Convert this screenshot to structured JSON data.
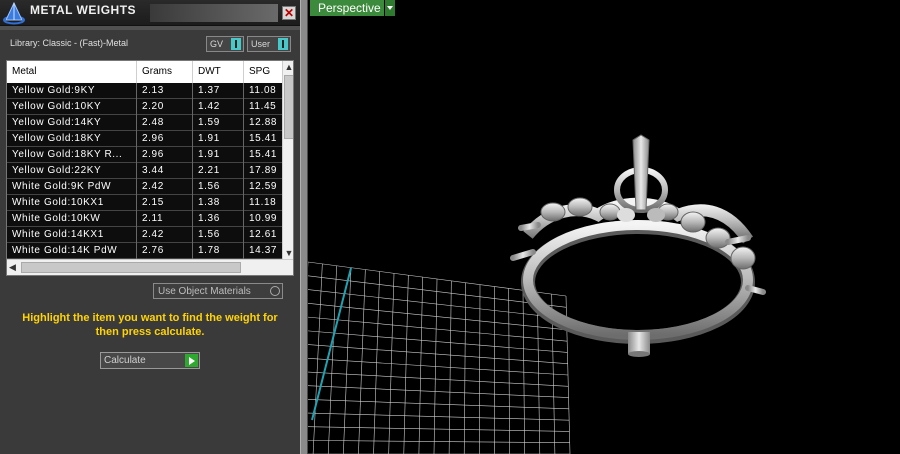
{
  "panel": {
    "title": "METAL WEIGHTS",
    "close_glyph": "✕",
    "library_label": "Library: Classic - (Fast)-Metal",
    "gv_select": "GV",
    "user_select": "User",
    "use_object_materials": "Use Object Materials",
    "hint": "Highlight the item you want to find the weight for then press calculate.",
    "calculate_label": "Calculate",
    "icons": {
      "logo": "pyramid-logo-icon",
      "close": "close-icon",
      "scroll_up": "arrow-up-icon",
      "scroll_down": "arrow-down-icon",
      "scroll_left": "arrow-left-icon",
      "calculate": "play-arrow-icon"
    }
  },
  "table": {
    "headers": [
      "Metal",
      "Grams",
      "DWT",
      "SPG"
    ],
    "rows": [
      [
        "Yellow Gold:9KY",
        "2.13",
        "1.37",
        "11.08"
      ],
      [
        "Yellow Gold:10KY",
        "2.20",
        "1.42",
        "11.45"
      ],
      [
        "Yellow Gold:14KY",
        "2.48",
        "1.59",
        "12.88"
      ],
      [
        "Yellow Gold:18KY",
        "2.96",
        "1.91",
        "15.41"
      ],
      [
        "Yellow Gold:18KY R...",
        "2.96",
        "1.91",
        "15.41"
      ],
      [
        "Yellow Gold:22KY",
        "3.44",
        "2.21",
        "17.89"
      ],
      [
        "White Gold:9K PdW",
        "2.42",
        "1.56",
        "12.59"
      ],
      [
        "White Gold:10KX1",
        "2.15",
        "1.38",
        "11.18"
      ],
      [
        "White Gold:10KW",
        "2.11",
        "1.36",
        "10.99"
      ],
      [
        "White Gold:14KX1",
        "2.42",
        "1.56",
        "12.61"
      ],
      [
        "White Gold:14K PdW",
        "2.76",
        "1.78",
        "14.37"
      ]
    ]
  },
  "viewport": {
    "view_name": "Perspective",
    "grid_color": "#cfcfcf",
    "axis_color": "#1fa3b3",
    "background": "#000000"
  },
  "colors": {
    "hint_text": "#ffd400",
    "accent_green": "#3c8a3c"
  }
}
